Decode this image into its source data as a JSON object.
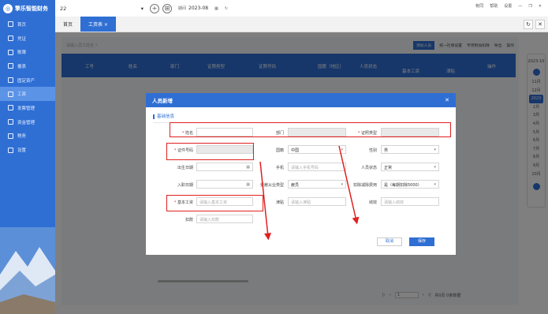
{
  "app": {
    "logo": "擎乐智能财务"
  },
  "sidebar": {
    "items": [
      {
        "label": "首页",
        "icon": "home-icon"
      },
      {
        "label": "凭证",
        "icon": "voucher-icon"
      },
      {
        "label": "账簿",
        "icon": "ledger-icon"
      },
      {
        "label": "报表",
        "icon": "report-icon"
      },
      {
        "label": "固定资产",
        "icon": "asset-icon"
      },
      {
        "label": "工资",
        "icon": "salary-icon"
      },
      {
        "label": "发票管理",
        "icon": "invoice-icon"
      },
      {
        "label": "资金管理",
        "icon": "fund-icon"
      },
      {
        "label": "税务",
        "icon": "tax-icon"
      },
      {
        "label": "设置",
        "icon": "gear-icon"
      }
    ],
    "active_index": 5
  },
  "topbar": {
    "account": "22",
    "period_label": "期间",
    "period_value": "2023-08",
    "links": [
      "帐同",
      "帮助",
      "设置"
    ]
  },
  "tabs": [
    {
      "label": "首页"
    },
    {
      "label": "工资表 ×"
    }
  ],
  "filter": {
    "search_placeholder": "请输入员工姓名",
    "buttons": [
      "添加人员",
      "统一社保设置",
      "专项附加扣除",
      "导出",
      "操作"
    ]
  },
  "table": {
    "headers": [
      "工号",
      "姓名",
      "部门",
      "证照类型",
      "证照号码",
      "国籍（地区）",
      "人员状态",
      "基本工资",
      "津贴",
      "操作"
    ]
  },
  "pager": {
    "page": "1",
    "total_pages_text": "共0页 0条数据"
  },
  "calendar": {
    "year": "2023-10",
    "months": [
      "1月",
      "2月",
      "3月",
      "4月",
      "5月",
      "6月",
      "7月",
      "8月",
      "9月",
      "10月",
      "11月",
      "12月"
    ],
    "selected": "2023"
  },
  "modal": {
    "title": "人员新增",
    "section": "基础信息",
    "fields": {
      "name": {
        "label": "姓名",
        "value": ""
      },
      "dept": {
        "label": "部门",
        "value": ""
      },
      "idtype": {
        "label": "证照类型",
        "value": ""
      },
      "idno": {
        "label": "证件号码",
        "value": ""
      },
      "nation": {
        "label": "国籍",
        "value": "中国"
      },
      "gender": {
        "label": "性别",
        "value": "男"
      },
      "birth": {
        "label": "出生日期",
        "value": ""
      },
      "phone": {
        "label": "手机",
        "placeholder": "请输入手机号码"
      },
      "status": {
        "label": "人员状态",
        "value": "正常"
      },
      "hire": {
        "label": "入职日期",
        "value": ""
      },
      "emptype": {
        "label": "受雇从业类型",
        "value": "雇员"
      },
      "deduct": {
        "label": "扣除减除费用",
        "value": "是（每期扣除5000）"
      },
      "salary": {
        "label": "基本工资",
        "placeholder": "请输入基本工资"
      },
      "allowance": {
        "label": "津贴",
        "placeholder": "请输入津贴"
      },
      "bonus": {
        "label": "绩效",
        "placeholder": "请输入绩效"
      },
      "deduction": {
        "label": "扣款",
        "placeholder": "请输入扣款"
      }
    },
    "cancel_label": "取消",
    "save_label": "保存"
  },
  "colors": {
    "primary": "#2f6fd4",
    "highlight": "#e02020"
  }
}
